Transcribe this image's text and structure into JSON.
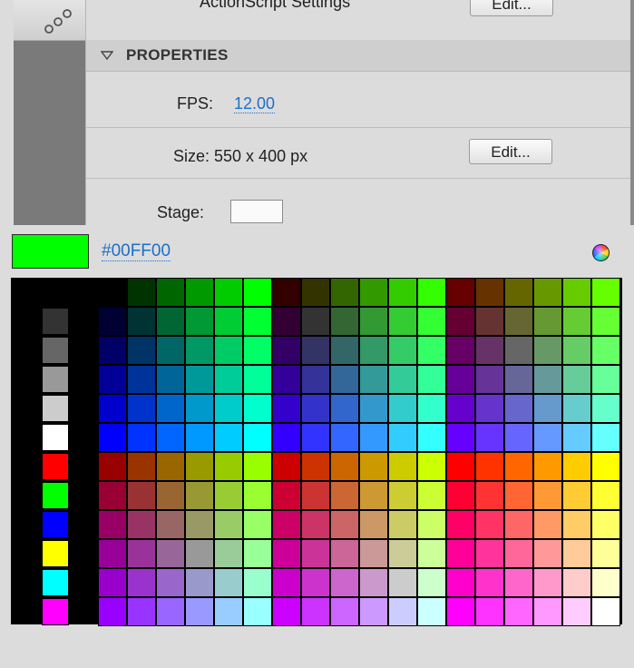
{
  "panel": {
    "actionscript_label": "ActionScript Settings",
    "actionscript_edit_label": "Edit...",
    "section_title": "PROPERTIES",
    "fps_label": "FPS:",
    "fps_value": "12.00",
    "size_label": "Size: 550 x 400 px",
    "size_edit_label": "Edit...",
    "stage_label": "Stage:"
  },
  "picker": {
    "hex_value": "#00FF00",
    "current_color": "#00FF00",
    "stage_color": "#FFFFFF",
    "wheel_icon": "color-wheel-icon"
  }
}
